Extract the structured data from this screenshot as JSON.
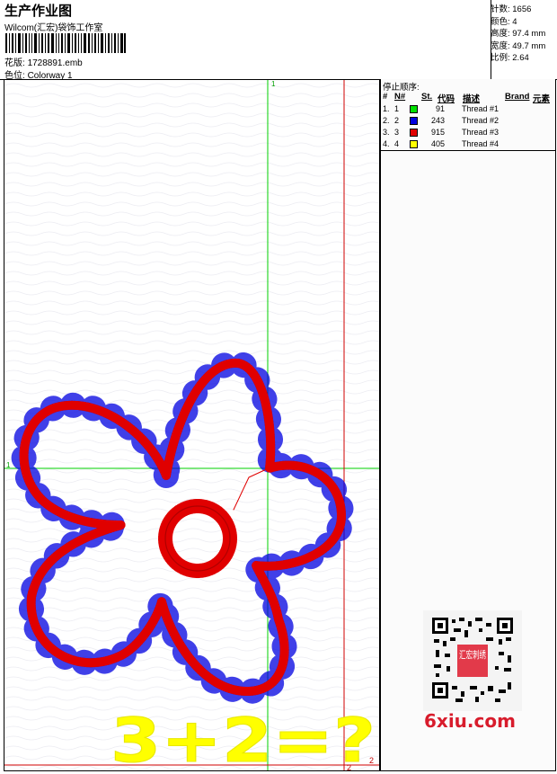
{
  "header": {
    "title": "生产作业图",
    "studio": "Wilcom(汇宏)袋饰工作室",
    "design_label": "花版:",
    "design_file": "1728891.emb",
    "colorway_label": "色位:",
    "colorway": "Colorway 1"
  },
  "stats": {
    "stitches": "针数: 1656",
    "colors": "颜色: 4",
    "height": "高度: 97.4 mm",
    "width": "宽度: 49.7 mm",
    "ratio": "比例: 2.64"
  },
  "stop_sequence": {
    "title": "停止顺序:",
    "headers": [
      "#",
      "N#",
      "St.",
      "代码",
      "描述",
      "Brand",
      "元素"
    ],
    "rows": [
      {
        "idx": "1.",
        "n": "1",
        "color": "#00e000",
        "stitches": "91",
        "desc": "Thread #1"
      },
      {
        "idx": "2.",
        "n": "2",
        "color": "#0000e0",
        "stitches": "243",
        "desc": "Thread #2"
      },
      {
        "idx": "3.",
        "n": "3",
        "color": "#e00000",
        "stitches": "915",
        "desc": "Thread #3"
      },
      {
        "idx": "4.",
        "n": "4",
        "color": "#ffff00",
        "stitches": "405",
        "desc": "Thread #4"
      }
    ]
  },
  "guides": {
    "top_marker": "1",
    "left_marker": "1",
    "bottom_marker_a": "2",
    "bottom_marker_b": "2"
  },
  "design_text": "3+2=?",
  "watermark": "6xiu.com",
  "qr_seal": "汇宏刺绣",
  "colors": {
    "guide_green": "#00d000",
    "guide_red": "#d00000",
    "thread_red": "#e00000",
    "thread_blue": "#0000e0",
    "thread_yellow": "#ffff00"
  }
}
